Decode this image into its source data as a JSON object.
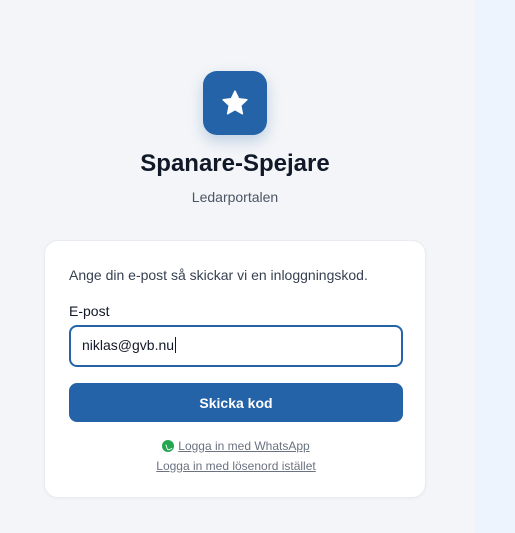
{
  "app": {
    "title": "Spanare-Spejare",
    "subtitle": "Ledarportalen",
    "logo_icon": "star-icon",
    "accent_color": "#2463a8"
  },
  "login": {
    "intro": "Ange din e-post så skickar vi en inloggningskod.",
    "email_label": "E-post",
    "email_value": "niklas@gvb.nu",
    "submit_label": "Skicka kod",
    "whatsapp_icon": "whatsapp-icon",
    "whatsapp_link": "Logga in med WhatsApp",
    "password_link": "Logga in med lösenord istället"
  }
}
